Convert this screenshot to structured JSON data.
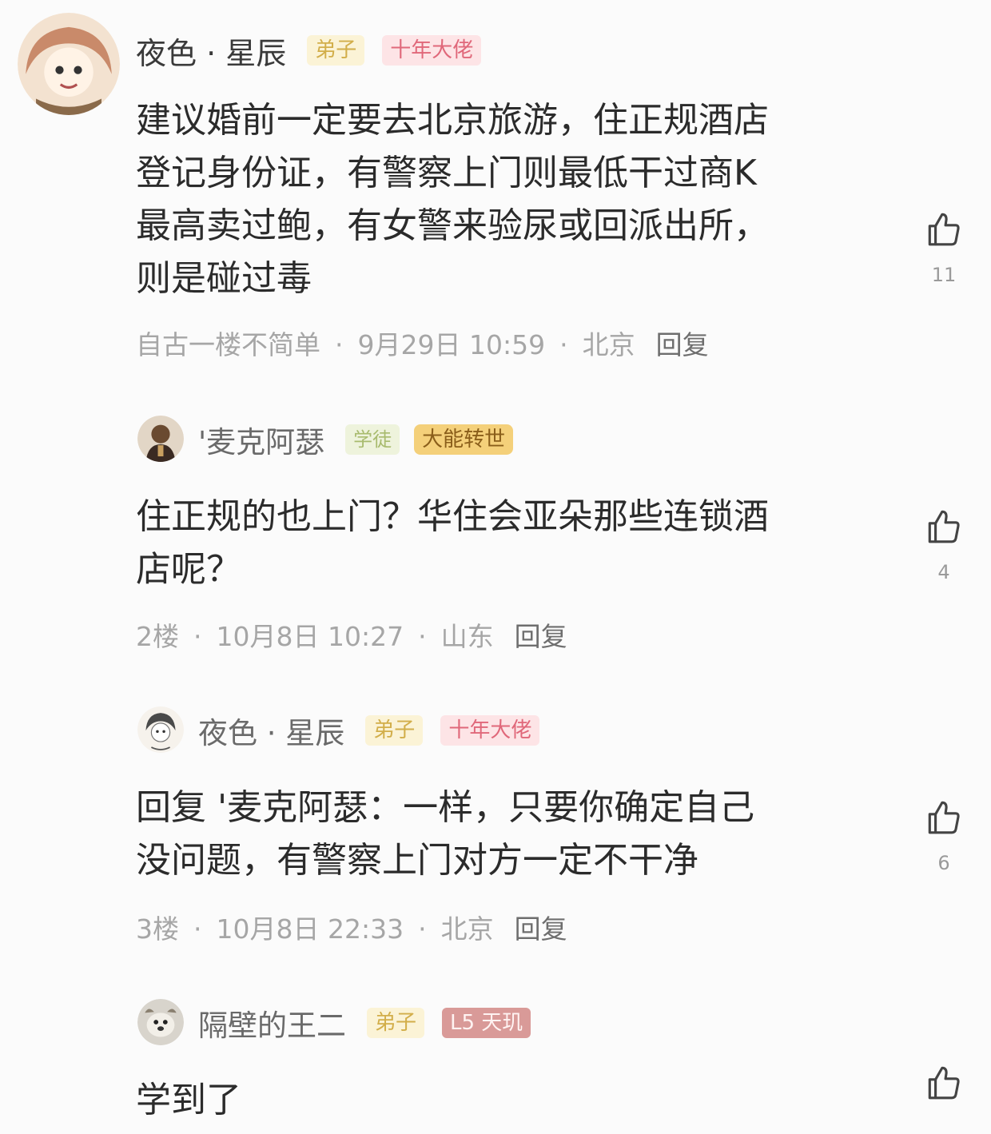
{
  "comments": [
    {
      "username": "夜色 · 星辰",
      "badges": [
        "弟子",
        "十年大佬"
      ],
      "lines": [
        "建议婚前一定要去北京旅游，住正规酒店",
        "登记身份证，有警察上门则最低干过商K",
        "最高卖过鲍，有女警来验尿或回派出所，",
        "则是碰过毒"
      ],
      "floor": "自古一楼不简单",
      "time": "9月29日 10:59",
      "location": "北京",
      "reply": "回复",
      "likes": "11"
    },
    {
      "username": "'麦克阿瑟",
      "badges": [
        "学徒",
        "大能转世"
      ],
      "lines": [
        "住正规的也上门？华住会亚朵那些连锁酒",
        "店呢？"
      ],
      "floor": "2楼",
      "time": "10月8日 10:27",
      "location": "山东",
      "reply": "回复",
      "likes": "4"
    },
    {
      "username": "夜色 · 星辰",
      "badges": [
        "弟子",
        "十年大佬"
      ],
      "lines": [
        "回复 '麦克阿瑟：一样，只要你确定自己",
        "没问题，有警察上门对方一定不干净"
      ],
      "floor": "3楼",
      "time": "10月8日 22:33",
      "location": "北京",
      "reply": "回复",
      "likes": "6"
    },
    {
      "username": "隔壁的王二",
      "badges": [
        "弟子",
        "L5 天玑"
      ],
      "lines": [
        "学到了"
      ],
      "likes": ""
    }
  ],
  "icons": {
    "like": "thumbs-up-icon"
  }
}
